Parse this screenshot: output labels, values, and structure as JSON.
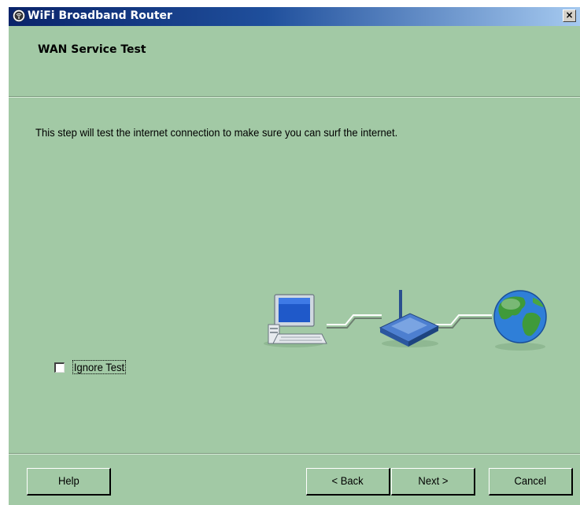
{
  "window": {
    "title": "WiFi Broadband Router",
    "close_label": "×"
  },
  "page": {
    "title": "WAN Service Test",
    "description": "This step will test the internet connection to make sure you can surf the internet."
  },
  "diagram": {
    "icons": [
      "computer-icon",
      "router-icon",
      "globe-icon"
    ]
  },
  "options": {
    "ignore_test_label": "Ignore Test",
    "ignore_test_checked": false
  },
  "buttons": {
    "help": "Help",
    "back": "< Back",
    "next": "Next >",
    "cancel": "Cancel"
  },
  "colors": {
    "dialog_background": "#a2c9a5",
    "titlebar_start": "#0a246a",
    "titlebar_end": "#a6caf0"
  }
}
